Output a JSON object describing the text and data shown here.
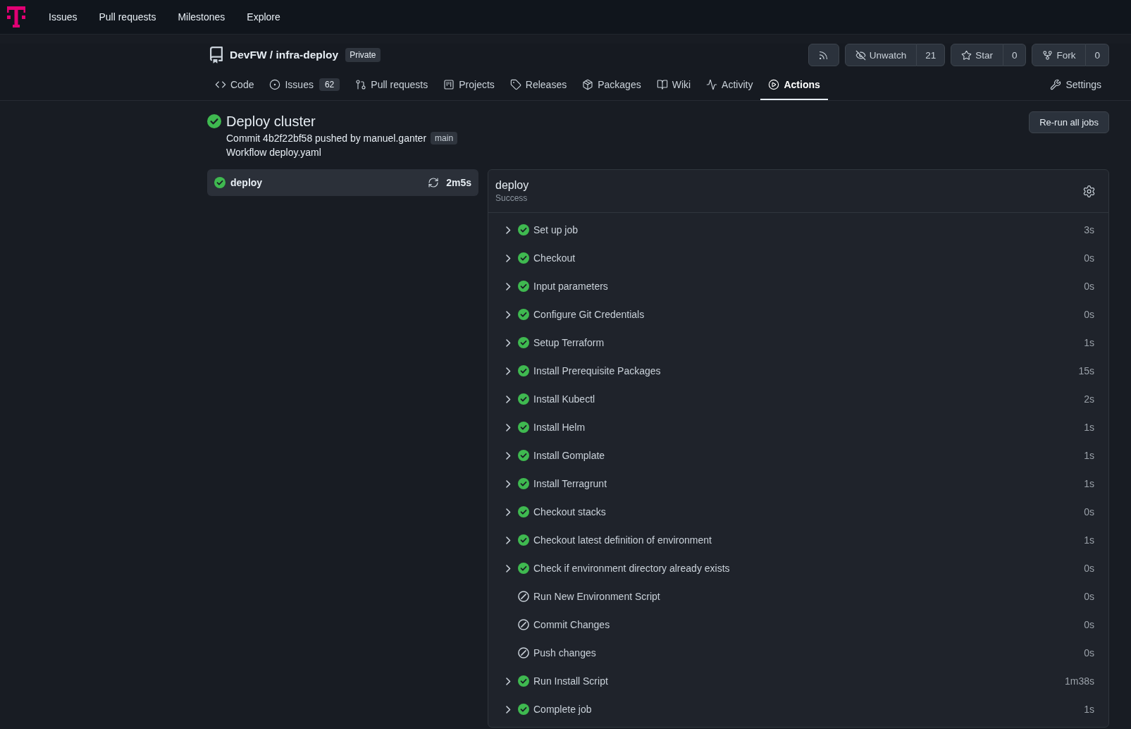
{
  "top_nav": {
    "links": [
      "Issues",
      "Pull requests",
      "Milestones",
      "Explore"
    ]
  },
  "repo": {
    "title": "DevFW / infra-deploy",
    "visibility": "Private"
  },
  "repo_actions": [
    {
      "kind": "rss"
    },
    {
      "kind": "watch",
      "label": "Unwatch",
      "count": "21"
    },
    {
      "kind": "star",
      "label": "Star",
      "count": "0"
    },
    {
      "kind": "fork",
      "label": "Fork",
      "count": "0"
    }
  ],
  "tabs": [
    {
      "kind": "code",
      "label": "Code",
      "selected": false
    },
    {
      "kind": "issues",
      "label": "Issues",
      "count": "62",
      "selected": false
    },
    {
      "kind": "pulls",
      "label": "Pull requests",
      "selected": false
    },
    {
      "kind": "projects",
      "label": "Projects",
      "selected": false
    },
    {
      "kind": "releases",
      "label": "Releases",
      "selected": false
    },
    {
      "kind": "packages",
      "label": "Packages",
      "selected": false
    },
    {
      "kind": "wiki",
      "label": "Wiki",
      "selected": false
    },
    {
      "kind": "activity",
      "label": "Activity",
      "selected": false
    },
    {
      "kind": "actions",
      "label": "Actions",
      "selected": true
    },
    {
      "kind": "settings",
      "label": "Settings",
      "selected": false
    }
  ],
  "run": {
    "succeeded": true,
    "title": "Deploy cluster",
    "commit": "Commit 4b2f22bf58 pushed by manuel.ganter",
    "branch": "main",
    "workflow": "Workflow deploy.yaml",
    "rerun_button": "Re-run all jobs"
  },
  "jobs": [
    {
      "name": "deploy",
      "succeeded": true,
      "duration": "2m5s",
      "selected": true
    }
  ],
  "job_panel": {
    "title": "deploy",
    "status_text": "Success",
    "steps": [
      {
        "name": "Set up job",
        "skipped": false,
        "expandable": true,
        "duration": "3s"
      },
      {
        "name": "Checkout",
        "skipped": false,
        "expandable": true,
        "duration": "0s"
      },
      {
        "name": "Input parameters",
        "skipped": false,
        "expandable": true,
        "duration": "0s"
      },
      {
        "name": "Configure Git Credentials",
        "skipped": false,
        "expandable": true,
        "duration": "0s"
      },
      {
        "name": "Setup Terraform",
        "skipped": false,
        "expandable": true,
        "duration": "1s"
      },
      {
        "name": "Install Prerequisite Packages",
        "skipped": false,
        "expandable": true,
        "duration": "15s"
      },
      {
        "name": "Install Kubectl",
        "skipped": false,
        "expandable": true,
        "duration": "2s"
      },
      {
        "name": "Install Helm",
        "skipped": false,
        "expandable": true,
        "duration": "1s"
      },
      {
        "name": "Install Gomplate",
        "skipped": false,
        "expandable": true,
        "duration": "1s"
      },
      {
        "name": "Install Terragrunt",
        "skipped": false,
        "expandable": true,
        "duration": "1s"
      },
      {
        "name": "Checkout stacks",
        "skipped": false,
        "expandable": true,
        "duration": "0s"
      },
      {
        "name": "Checkout latest definition of environment",
        "skipped": false,
        "expandable": true,
        "duration": "1s"
      },
      {
        "name": "Check if environment directory already exists",
        "skipped": false,
        "expandable": true,
        "duration": "0s"
      },
      {
        "name": "Run New Environment Script",
        "skipped": true,
        "expandable": false,
        "duration": "0s"
      },
      {
        "name": "Commit Changes",
        "skipped": true,
        "expandable": false,
        "duration": "0s"
      },
      {
        "name": "Push changes",
        "skipped": true,
        "expandable": false,
        "duration": "0s"
      },
      {
        "name": "Run Install Script",
        "skipped": false,
        "expandable": true,
        "duration": "1m38s"
      },
      {
        "name": "Complete job",
        "skipped": false,
        "expandable": true,
        "duration": "1s"
      }
    ]
  }
}
